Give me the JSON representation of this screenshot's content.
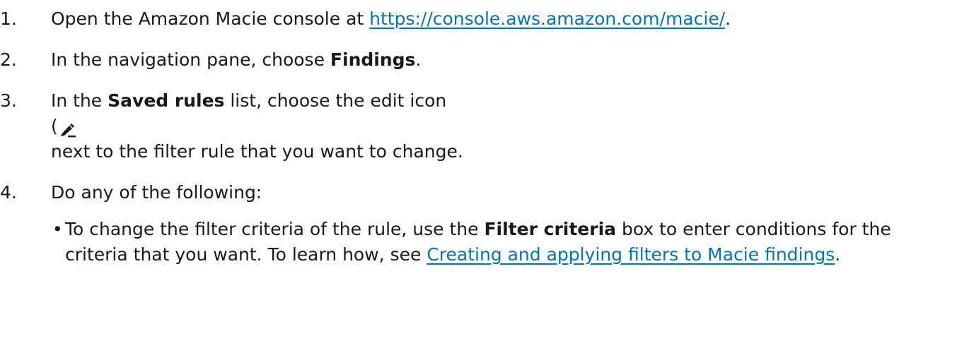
{
  "steps": [
    {
      "num": "1.",
      "text_before": "Open the Amazon Macie console at ",
      "link": "https://console.aws.amazon.com/macie/",
      "text_after": "."
    },
    {
      "num": "2.",
      "text_before": "In the navigation pane, choose ",
      "bold": "Findings",
      "text_after": "."
    },
    {
      "num": "3.",
      "text_before": "In the ",
      "bold": "Saved rules",
      "text_mid": " list, choose the edit icon",
      "paren": "(",
      "icon": "edit-icon",
      "text_after": "next to the filter rule that you want to change."
    },
    {
      "num": "4.",
      "text": "Do any of the following:",
      "bullets": [
        {
          "dot": "•",
          "text_before": "To change the filter criteria of the rule, use the ",
          "bold": "Filter criteria",
          "text_mid": " box to enter conditions for the criteria that you want. To learn how, see ",
          "link": "Creating and applying filters to Macie findings",
          "text_after": "."
        }
      ]
    }
  ]
}
